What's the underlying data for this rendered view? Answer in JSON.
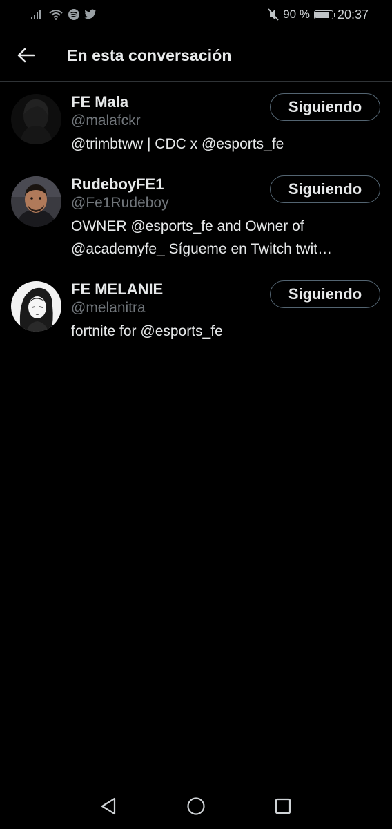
{
  "status_bar": {
    "left_icons": [
      "signal-icon",
      "wifi-icon",
      "spotify-icon",
      "twitter-icon"
    ],
    "mute_icon": "mute-icon",
    "battery_text": "90 %",
    "battery_level_percent": 90,
    "time": "20:37"
  },
  "header": {
    "back_icon": "back-arrow-icon",
    "title": "En esta conversación"
  },
  "users": [
    {
      "name": "FE Mala",
      "handle": "@malafckr",
      "bio_lines": [
        "@trimbtww | CDC x @esports_fe"
      ],
      "follow_label": "Siguiendo"
    },
    {
      "name": "RudeboyFE1",
      "handle": "@Fe1Rudeboy",
      "bio_lines": [
        "OWNER @esports_fe and Owner of",
        "@academyfe_ Sígueme en Twitch twit…"
      ],
      "follow_label": "Siguiendo"
    },
    {
      "name": "FE MELANIE",
      "handle": "@melanitra",
      "bio_lines": [
        "fortnite for @esports_fe"
      ],
      "follow_label": "Siguiendo"
    }
  ],
  "nav_bar": {
    "back_icon": "nav-back-icon",
    "home_icon": "nav-home-icon",
    "recents_icon": "nav-recents-icon"
  },
  "colors": {
    "background": "#000000",
    "text_primary": "#e7e9ea",
    "text_secondary": "#71767b",
    "divider": "#2f3336",
    "button_border": "#536471"
  }
}
